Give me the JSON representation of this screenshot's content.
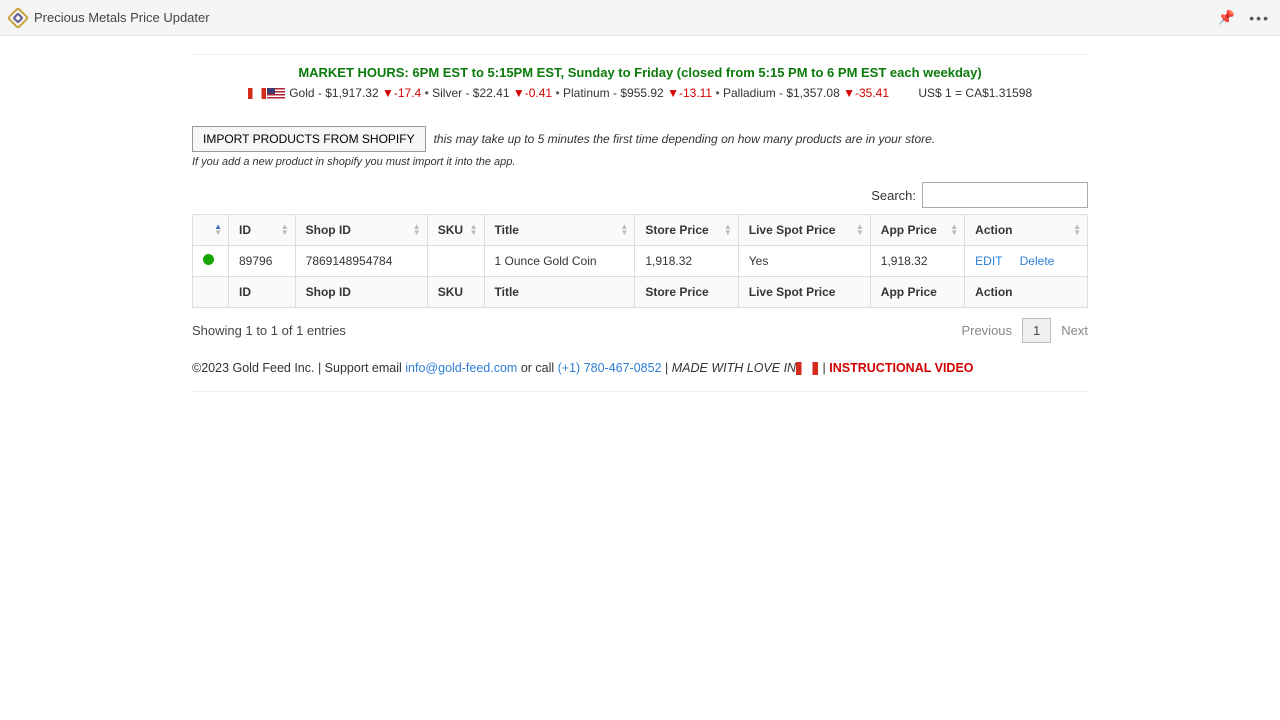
{
  "titlebar": {
    "title": "Precious Metals Price Updater"
  },
  "market_hours": "MARKET HOURS: 6PM EST to 5:15PM EST, Sunday to Friday (closed from 5:15 PM to 6 PM EST each weekday)",
  "ticker": {
    "gold": {
      "label": "Gold",
      "price": "$1,917.32",
      "delta": "-17.4"
    },
    "silver": {
      "label": "Silver",
      "price": "$22.41",
      "delta": "-0.41"
    },
    "platinum": {
      "label": "Platinum",
      "price": "$955.92",
      "delta": "-13.11"
    },
    "palladium": {
      "label": "Palladium",
      "price": "$1,357.08",
      "delta": "-35.41"
    },
    "fx": "US$ 1 = CA$1.31598"
  },
  "import": {
    "button": "IMPORT PRODUCTS FROM SHOPIFY",
    "note": "this may take up to 5 minutes the first time depending on how many products are in your store.",
    "subnote": "If you add a new product in shopify you must import it into the app."
  },
  "search": {
    "label": "Search:"
  },
  "columns": {
    "c0": "",
    "id": "ID",
    "shop_id": "Shop ID",
    "sku": "SKU",
    "title": "Title",
    "store_price": "Store Price",
    "live_spot": "Live Spot Price",
    "app_price": "App Price",
    "action": "Action"
  },
  "rows": [
    {
      "id": "89796",
      "shop_id": "7869148954784",
      "sku": "",
      "title": "1 Ounce Gold Coin",
      "store_price": "1,918.32",
      "live_spot": "Yes",
      "app_price": "1,918.32",
      "edit": "EDIT",
      "delete": "Delete"
    }
  ],
  "entries": "Showing 1 to 1 of 1 entries",
  "pager": {
    "prev": "Previous",
    "page": "1",
    "next": "Next"
  },
  "footer": {
    "copyright": "©2023 Gold Feed Inc. | Support email ",
    "email": "info@gold-feed.com",
    "or_call": " or call ",
    "phone": "(+1) 780-467-0852",
    "pipe1": " | ",
    "made": "MADE WITH LOVE IN",
    "pipe2": " | ",
    "video": "INSTRUCTIONAL VIDEO"
  }
}
